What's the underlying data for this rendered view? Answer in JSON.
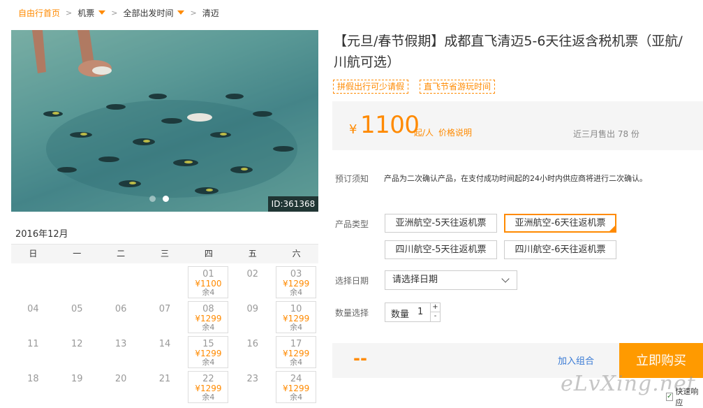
{
  "breadcrumb": {
    "home": "自由行首页",
    "item1": "机票",
    "item2": "全部出发时间",
    "current": "清迈",
    "separator": ">"
  },
  "photo": {
    "id_label": "ID:361368",
    "slides": 2,
    "active_slide": 2
  },
  "calendar": {
    "month": "2016年12月",
    "weekdays": [
      "日",
      "一",
      "二",
      "三",
      "四",
      "五",
      "六"
    ],
    "row1": {
      "d01": "01",
      "p01": "¥1100",
      "r01": "余4",
      "d02": "02",
      "d03": "03",
      "p03": "¥1299",
      "r03": "余4"
    },
    "row2": {
      "d04": "04",
      "d05": "05",
      "d06": "06",
      "d07": "07",
      "d08": "08",
      "p08": "¥1299",
      "r08": "余4",
      "d09": "09",
      "d10": "10",
      "p10": "¥1299",
      "r10": "余4"
    },
    "row3": {
      "d11": "11",
      "d12": "12",
      "d13": "13",
      "d14": "14",
      "d15": "15",
      "p15": "¥1299",
      "r15": "余4",
      "d16": "16",
      "d17": "17",
      "p17": "¥1299",
      "r17": "余4"
    },
    "row4": {
      "d18": "18",
      "d19": "19",
      "d20": "20",
      "d21": "21",
      "d22": "22",
      "p22": "¥1299",
      "r22": "余4",
      "d23": "23",
      "d24": "24",
      "p24": "¥1299",
      "r24": "余4"
    }
  },
  "product": {
    "title": "【元旦/春节假期】成都直飞清迈5-6天往返含税机票（亚航/川航可选）",
    "tags": [
      "拼假出行可少请假",
      "直飞节省游玩时间"
    ],
    "price_symbol": "¥",
    "price": "1100",
    "price_unit": "起/人",
    "price_info": "价格说明",
    "sold": "近三月售出 78 份"
  },
  "booking": {
    "notice_label": "预订须知",
    "notice_text": "产品为二次确认产品，在支付成功时间起的24小时内供应商将进行二次确认。",
    "type_label": "产品类型",
    "options": [
      "亚洲航空-5天往返机票",
      "亚洲航空-6天往返机票",
      "四川航空-5天往返机票",
      "四川航空-6天往返机票"
    ],
    "selected_option": "亚洲航空-6天往返机票",
    "date_label": "选择日期",
    "date_placeholder": "请选择日期",
    "qty_label": "数量选择",
    "qty_inner_label": "数量",
    "qty_value": "1",
    "qty_plus": "+",
    "qty_minus": "-",
    "total": "--",
    "add_combo": "加入组合",
    "buy_now": "立即购买"
  },
  "overlay": {
    "watermark": "eLvXing.net",
    "quick_reply": "快速响应",
    "check_mark": "✓"
  },
  "colors": {
    "accent": "#ff8a00",
    "buy_button": "#ff9a00",
    "link": "#3a7bd5",
    "panel_bg": "#f5f5f5"
  }
}
